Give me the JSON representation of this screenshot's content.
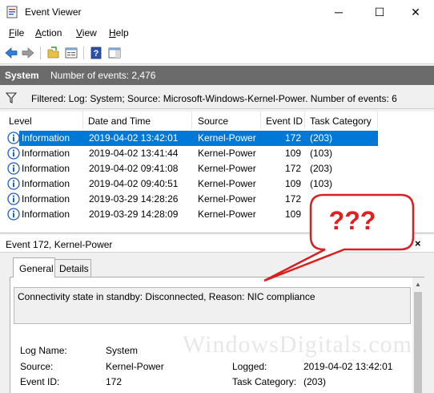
{
  "window": {
    "title": "Event Viewer",
    "minimize": "─",
    "maximize": "☐",
    "close": "✕"
  },
  "menu": [
    {
      "key": "F",
      "rest": "ile"
    },
    {
      "key": "A",
      "rest": "ction"
    },
    {
      "key": "V",
      "rest": "iew"
    },
    {
      "key": "H",
      "rest": "elp"
    }
  ],
  "toolbar_icons": [
    "back-arrow-icon",
    "forward-arrow-icon",
    "open-folder-icon",
    "properties-icon",
    "help-icon",
    "show-pane-icon"
  ],
  "log": {
    "name": "System",
    "count_text": "Number of events: 2,476"
  },
  "filter": {
    "text": "Filtered: Log: System; Source: Microsoft-Windows-Kernel-Power. Number of events: 6"
  },
  "columns": [
    "Level",
    "Date and Time",
    "Source",
    "Event ID",
    "Task Category"
  ],
  "events": [
    {
      "level": "Information",
      "datetime": "2019-04-02 13:42:01",
      "source": "Kernel-Power",
      "id": "172",
      "category": "(203)",
      "selected": true
    },
    {
      "level": "Information",
      "datetime": "2019-04-02 13:41:44",
      "source": "Kernel-Power",
      "id": "109",
      "category": "(103)",
      "selected": false
    },
    {
      "level": "Information",
      "datetime": "2019-04-02 09:41:08",
      "source": "Kernel-Power",
      "id": "172",
      "category": "(203)",
      "selected": false
    },
    {
      "level": "Information",
      "datetime": "2019-04-02 09:40:51",
      "source": "Kernel-Power",
      "id": "109",
      "category": "(103)",
      "selected": false
    },
    {
      "level": "Information",
      "datetime": "2019-03-29 14:28:26",
      "source": "Kernel-Power",
      "id": "172",
      "category": "",
      "selected": false
    },
    {
      "level": "Information",
      "datetime": "2019-03-29 14:28:09",
      "source": "Kernel-Power",
      "id": "109",
      "category": "",
      "selected": false
    }
  ],
  "annotation": {
    "text": "???",
    "color": "#e02020"
  },
  "detail": {
    "title": "Event 172, Kernel-Power",
    "close": "×",
    "tabs": [
      "General",
      "Details"
    ],
    "description": "Connectivity state in standby: Disconnected, Reason: NIC compliance",
    "fields": {
      "log_name_label": "Log Name:",
      "log_name": "System",
      "source_label": "Source:",
      "source": "Kernel-Power",
      "logged_label": "Logged:",
      "logged": "2019-04-02 13:42:01",
      "event_id_label": "Event ID:",
      "event_id": "172",
      "task_category_label": "Task Category:",
      "task_category": "(203)"
    }
  },
  "watermark": "WindowsDigitals.com",
  "colors": {
    "selection": "#0078d7",
    "header_band": "#6b6b6b",
    "info_icon": "#1f5fbf"
  }
}
